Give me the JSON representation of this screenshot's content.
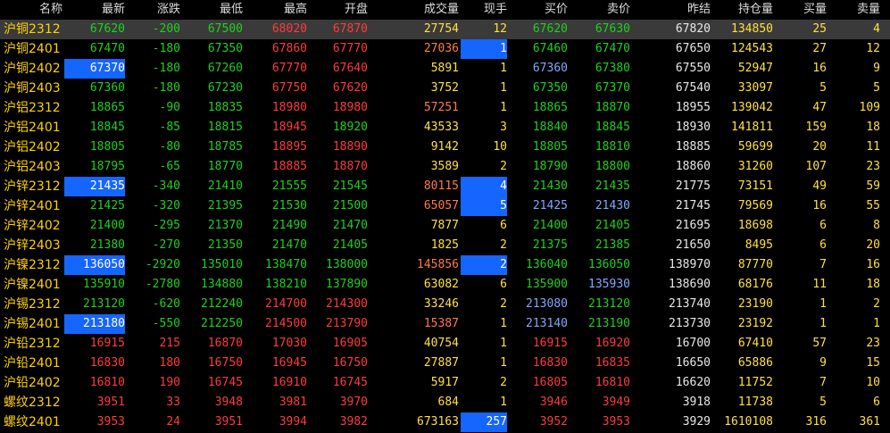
{
  "headers": [
    "名称",
    "最新",
    "涨跌",
    "最低",
    "最高",
    "开盘",
    "成交量",
    "现手",
    "买价",
    "卖价",
    "昨结",
    "持仓量",
    "买量",
    "卖量"
  ],
  "colors": {
    "up": "#ff3b3b",
    "down": "#1fd11f",
    "neutral": "#e8e8e8",
    "volume": "#ffe040",
    "highlight": "#1565ff"
  },
  "rows": [
    {
      "name": "沪铜2312",
      "last": "67620",
      "chg": "-200",
      "low": "67500",
      "high": "68020",
      "open": "67870",
      "vol": "27754",
      "cur": "12",
      "bid": "67620",
      "ask": "67630",
      "pre": "67820",
      "oi": "134850",
      "bq": "25",
      "aq": "4",
      "selected": true
    },
    {
      "name": "沪铜2401",
      "last": "67470",
      "chg": "-180",
      "low": "67350",
      "high": "67860",
      "open": "67770",
      "vol": "27036",
      "cur": "1",
      "bid": "67460",
      "ask": "67470",
      "pre": "67650",
      "oi": "124543",
      "bq": "27",
      "aq": "12"
    },
    {
      "name": "沪铜2402",
      "last": "67370",
      "chg": "-180",
      "low": "67260",
      "high": "67770",
      "open": "67640",
      "vol": "5891",
      "cur": "1",
      "bid": "67360",
      "ask": "67380",
      "pre": "67550",
      "oi": "52947",
      "bq": "16",
      "aq": "9"
    },
    {
      "name": "沪铜2403",
      "last": "67360",
      "chg": "-180",
      "low": "67230",
      "high": "67750",
      "open": "67620",
      "vol": "3752",
      "cur": "1",
      "bid": "67350",
      "ask": "67370",
      "pre": "67540",
      "oi": "33097",
      "bq": "5",
      "aq": "5"
    },
    {
      "name": "沪铝2312",
      "last": "18865",
      "chg": "-90",
      "low": "18835",
      "high": "18980",
      "open": "18980",
      "vol": "57251",
      "cur": "1",
      "bid": "18865",
      "ask": "18870",
      "pre": "18955",
      "oi": "139042",
      "bq": "47",
      "aq": "109"
    },
    {
      "name": "沪铝2401",
      "last": "18845",
      "chg": "-85",
      "low": "18815",
      "high": "18945",
      "open": "18920",
      "vol": "43533",
      "cur": "3",
      "bid": "18840",
      "ask": "18845",
      "pre": "18930",
      "oi": "141811",
      "bq": "159",
      "aq": "18"
    },
    {
      "name": "沪铝2402",
      "last": "18805",
      "chg": "-80",
      "low": "18785",
      "high": "18895",
      "open": "18890",
      "vol": "9142",
      "cur": "10",
      "bid": "18805",
      "ask": "18810",
      "pre": "18885",
      "oi": "59699",
      "bq": "20",
      "aq": "11"
    },
    {
      "name": "沪铝2403",
      "last": "18795",
      "chg": "-65",
      "low": "18770",
      "high": "18885",
      "open": "18870",
      "vol": "3589",
      "cur": "2",
      "bid": "18790",
      "ask": "18800",
      "pre": "18860",
      "oi": "31260",
      "bq": "107",
      "aq": "23"
    },
    {
      "name": "沪锌2312",
      "last": "21435",
      "chg": "-340",
      "low": "21410",
      "high": "21555",
      "open": "21545",
      "vol": "80115",
      "cur": "4",
      "bid": "21430",
      "ask": "21435",
      "pre": "21775",
      "oi": "73151",
      "bq": "49",
      "aq": "59"
    },
    {
      "name": "沪锌2401",
      "last": "21425",
      "chg": "-320",
      "low": "21395",
      "high": "21530",
      "open": "21500",
      "vol": "65057",
      "cur": "5",
      "bid": "21425",
      "ask": "21430",
      "pre": "21745",
      "oi": "79569",
      "bq": "16",
      "aq": "55"
    },
    {
      "name": "沪锌2402",
      "last": "21400",
      "chg": "-295",
      "low": "21370",
      "high": "21490",
      "open": "21470",
      "vol": "7877",
      "cur": "6",
      "bid": "21400",
      "ask": "21405",
      "pre": "21695",
      "oi": "18698",
      "bq": "6",
      "aq": "8"
    },
    {
      "name": "沪锌2403",
      "last": "21380",
      "chg": "-270",
      "low": "21350",
      "high": "21470",
      "open": "21405",
      "vol": "1825",
      "cur": "2",
      "bid": "21375",
      "ask": "21385",
      "pre": "21650",
      "oi": "8495",
      "bq": "6",
      "aq": "20"
    },
    {
      "name": "沪镍2312",
      "last": "136050",
      "chg": "-2920",
      "low": "135010",
      "high": "138470",
      "open": "138000",
      "vol": "145856",
      "cur": "2",
      "bid": "136040",
      "ask": "136050",
      "pre": "138970",
      "oi": "87770",
      "bq": "7",
      "aq": "16"
    },
    {
      "name": "沪镍2401",
      "last": "135910",
      "chg": "-2780",
      "low": "134880",
      "high": "138210",
      "open": "137890",
      "vol": "63082",
      "cur": "6",
      "bid": "135900",
      "ask": "135930",
      "pre": "138690",
      "oi": "68176",
      "bq": "11",
      "aq": "18"
    },
    {
      "name": "沪锡2312",
      "last": "213120",
      "chg": "-620",
      "low": "212240",
      "high": "214700",
      "open": "214300",
      "vol": "33246",
      "cur": "2",
      "bid": "213080",
      "ask": "213120",
      "pre": "213740",
      "oi": "23190",
      "bq": "1",
      "aq": "2"
    },
    {
      "name": "沪锡2401",
      "last": "213180",
      "chg": "-550",
      "low": "212250",
      "high": "214500",
      "open": "213790",
      "vol": "15387",
      "cur": "1",
      "bid": "213140",
      "ask": "213190",
      "pre": "213730",
      "oi": "23192",
      "bq": "1",
      "aq": "1"
    },
    {
      "name": "沪铅2312",
      "last": "16915",
      "chg": "215",
      "low": "16870",
      "high": "17030",
      "open": "16905",
      "vol": "40754",
      "cur": "1",
      "bid": "16915",
      "ask": "16920",
      "pre": "16700",
      "oi": "67410",
      "bq": "57",
      "aq": "23"
    },
    {
      "name": "沪铅2401",
      "last": "16830",
      "chg": "180",
      "low": "16750",
      "high": "16945",
      "open": "16750",
      "vol": "27887",
      "cur": "1",
      "bid": "16830",
      "ask": "16835",
      "pre": "16650",
      "oi": "65886",
      "bq": "9",
      "aq": "15"
    },
    {
      "name": "沪铅2402",
      "last": "16810",
      "chg": "190",
      "low": "16745",
      "high": "16910",
      "open": "16745",
      "vol": "5917",
      "cur": "2",
      "bid": "16805",
      "ask": "16810",
      "pre": "16620",
      "oi": "11752",
      "bq": "7",
      "aq": "10"
    },
    {
      "name": "螺纹2312",
      "last": "3951",
      "chg": "33",
      "low": "3948",
      "high": "3981",
      "open": "3970",
      "vol": "684",
      "cur": "1",
      "bid": "3946",
      "ask": "3949",
      "pre": "3918",
      "oi": "11738",
      "bq": "5",
      "aq": "6"
    },
    {
      "name": "螺纹2401",
      "last": "3953",
      "chg": "24",
      "low": "3951",
      "high": "3994",
      "open": "3982",
      "vol": "673163",
      "cur": "257",
      "bid": "3952",
      "ask": "3953",
      "pre": "3929",
      "oi": "1610108",
      "bq": "316",
      "aq": "361"
    }
  ]
}
